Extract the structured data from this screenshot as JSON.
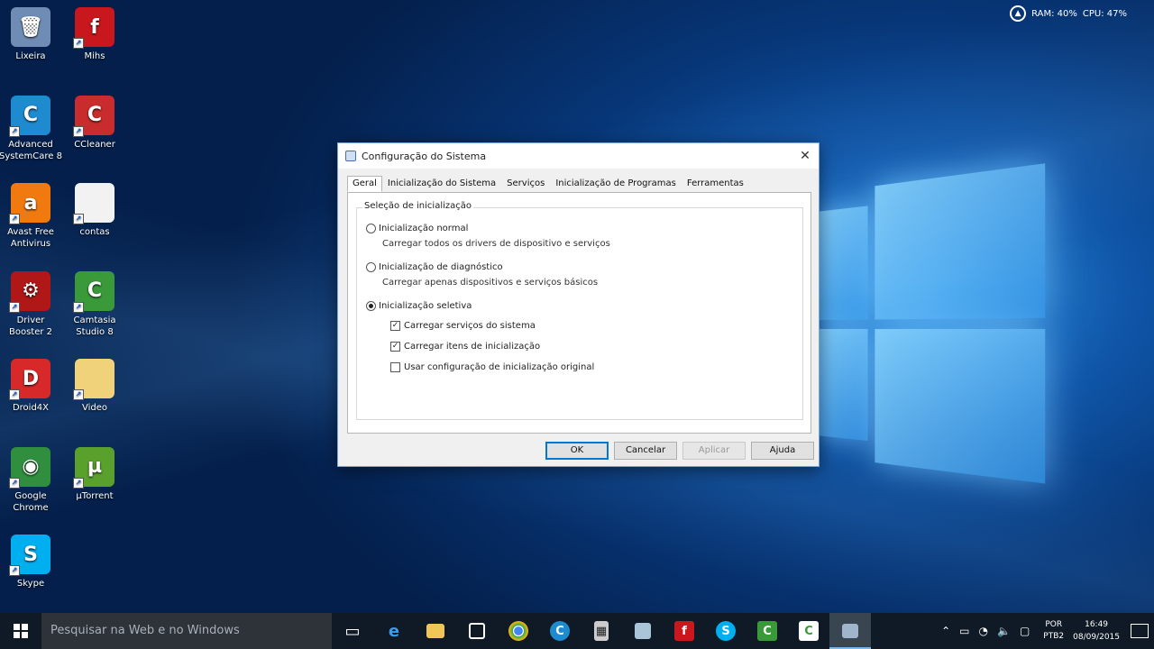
{
  "desktop": {
    "icons": [
      {
        "label": "Lixeira",
        "glyph": "🗑",
        "color": "#6f8db4"
      },
      {
        "label": "Mihs",
        "glyph": "f",
        "color": "#c8171d"
      },
      {
        "label": "Advanced SystemCare 8",
        "glyph": "C",
        "color": "#1e8ad0"
      },
      {
        "label": "CCleaner",
        "glyph": "C",
        "color": "#c92c2c"
      },
      {
        "label": "Avast Free Antivirus",
        "glyph": "a",
        "color": "#f07a10"
      },
      {
        "label": "contas",
        "glyph": "",
        "color": "#f2f2f2"
      },
      {
        "label": "Driver Booster 2",
        "glyph": "⚙",
        "color": "#b01818"
      },
      {
        "label": "Camtasia Studio 8",
        "glyph": "C",
        "color": "#3a9a3a"
      },
      {
        "label": "Droid4X",
        "glyph": "D",
        "color": "#d72929"
      },
      {
        "label": "Video",
        "glyph": "",
        "color": "#f0d27a"
      },
      {
        "label": "Google Chrome",
        "glyph": "◉",
        "color": "#2f8f3f"
      },
      {
        "label": "µTorrent",
        "glyph": "µ",
        "color": "#5aa02c"
      },
      {
        "label": "Skype",
        "glyph": "S",
        "color": "#00aff0"
      }
    ]
  },
  "meter": {
    "icon": "meter-icon",
    "ram": "RAM: 40%",
    "cpu": "CPU: 47%"
  },
  "dialog": {
    "title": "Configuração do Sistema",
    "close": "✕",
    "tabs": [
      "Geral",
      "Inicialização do Sistema",
      "Serviços",
      "Inicialização de Programas",
      "Ferramentas"
    ],
    "active_tab": "Geral",
    "group_label": "Seleção de inicialização",
    "options": [
      {
        "label": "Inicialização normal",
        "desc": "Carregar todos os drivers de dispositivo e serviços",
        "selected": false
      },
      {
        "label": "Inicialização de diagnóstico",
        "desc": "Carregar apenas dispositivos e serviços básicos",
        "selected": false
      },
      {
        "label": "Inicialização seletiva",
        "desc": "",
        "selected": true
      }
    ],
    "checks": [
      {
        "label": "Carregar serviços do sistema",
        "checked": true
      },
      {
        "label": "Carregar itens de inicialização",
        "checked": true
      },
      {
        "label": "Usar configuração de inicialização original",
        "checked": false
      }
    ],
    "buttons": {
      "ok": "OK",
      "cancel": "Cancelar",
      "apply": "Aplicar",
      "help": "Ajuda"
    }
  },
  "taskbar": {
    "search_placeholder": "Pesquisar na Web e no Windows",
    "lang_top": "POR",
    "lang_bottom": "PTB2",
    "time": "16:49",
    "date": "08/09/2015"
  }
}
